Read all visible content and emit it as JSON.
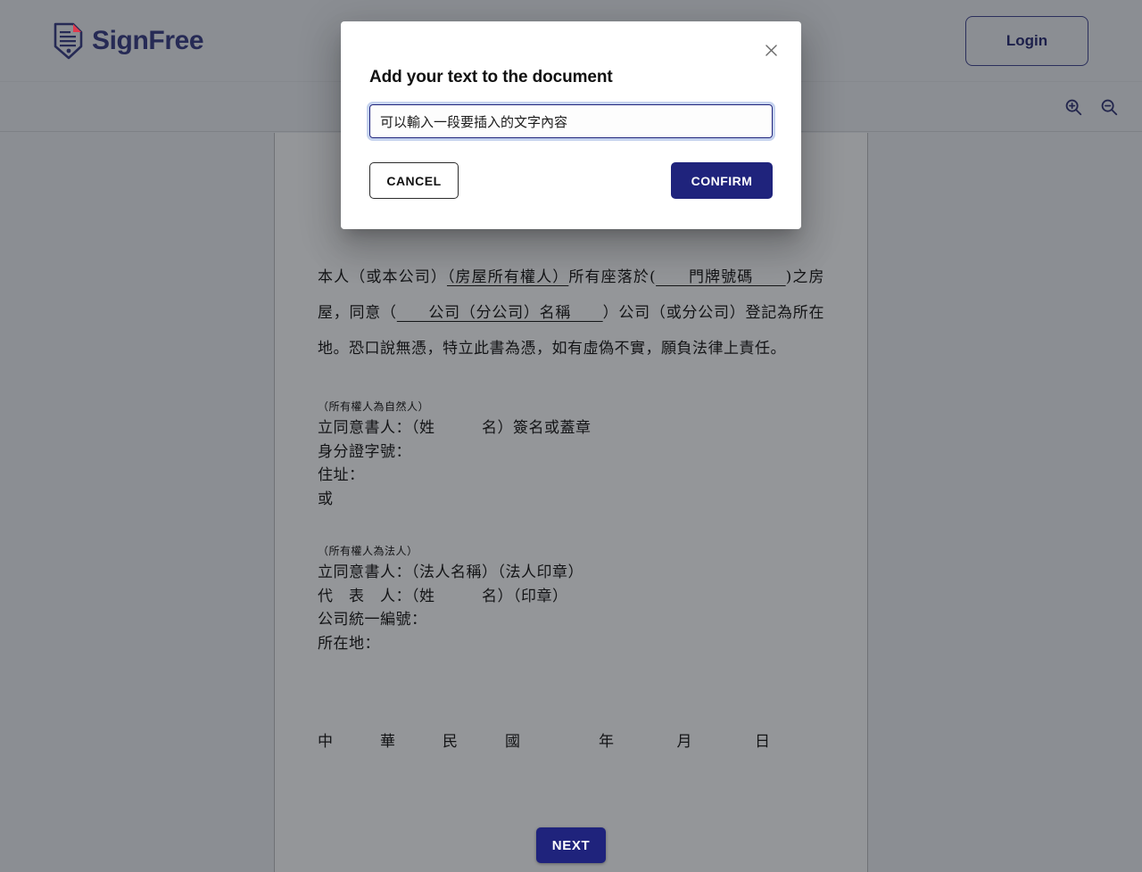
{
  "header": {
    "brand_name": "SignFree",
    "brand_icon": "document-pen-logo-icon",
    "login_label": "Login"
  },
  "toolbar": {
    "kebab_icon": "more-vertical-icon",
    "zoom_in_icon": "magnifier-plus-icon",
    "zoom_out_icon": "magnifier-minus-icon"
  },
  "document": {
    "title": "",
    "paragraph_line_1_a": "本人（或本公司）",
    "paragraph_line_1_b": "（房屋所有權人）",
    "paragraph_line_1_c": "所有座落於(",
    "paragraph_line_1_d": "　　門牌號碼　　",
    "paragraph_line_1_e": ")之房屋，同意（",
    "paragraph_line_1_f": "　　公司（分公司）名稱　　",
    "paragraph_line_1_g": "）公司（或分公司）登記為所在地。恐口說無憑，特立此書為憑，如有虛偽不實，願負法律上責任。",
    "natural_person": {
      "note": "（所有權人為自然人）",
      "lines": [
        "立同意書人：（姓　　　名）簽名或蓋章",
        "身分證字號：",
        "住址：",
        "或"
      ]
    },
    "legal_person": {
      "note": "（所有權人為法人）",
      "lines": [
        "立同意書人：（法人名稱）（法人印章）",
        "代　表　人：（姓　　　名）（印章）",
        "公司統一編號：",
        "所在地："
      ]
    },
    "date_line": "中　　　華　　　民　　　國　　　　　年　　　　月　　　　日",
    "next_label": "NEXT"
  },
  "modal": {
    "title": "Add your text to the document",
    "close_icon": "close-icon",
    "input_value": "可以輸入一段要插入的文字內容",
    "input_placeholder": "",
    "cancel_label": "CANCEL",
    "confirm_label": "CONFIRM"
  },
  "colors": {
    "brand_navy": "#262a55",
    "accent_blue": "#1f237c",
    "logo_red": "#e03a4e",
    "backdrop_gray": "#8b8e93",
    "page_gray": "#949699"
  }
}
